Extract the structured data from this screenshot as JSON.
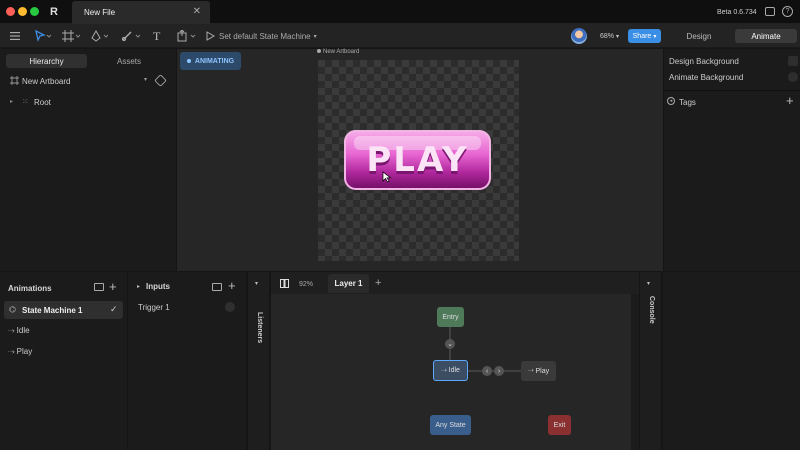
{
  "window": {
    "tab_title": "New File",
    "version": "Beta 0.6.734"
  },
  "toolbar": {
    "state_machine_label": "Set default State Machine",
    "zoom": "68%",
    "share_label": "Share",
    "mode_tabs": [
      "Design",
      "Animate"
    ],
    "active_mode": "Animate"
  },
  "left_panel": {
    "tabs": [
      "Hierarchy",
      "Assets"
    ],
    "artboard_name": "New Artboard",
    "root_label": "Root"
  },
  "canvas": {
    "animating_badge": "ANIMATING",
    "artboard_label": "New Artboard",
    "button_text": "PLAY"
  },
  "right_panel": {
    "design_background": "Design Background",
    "animate_background": "Animate Background",
    "tags_label": "Tags"
  },
  "animations": {
    "title": "Animations",
    "items": [
      "State Machine 1",
      "Idle",
      "Play"
    ]
  },
  "inputs": {
    "title": "Inputs",
    "items": [
      "Trigger 1"
    ]
  },
  "listeners_label": "Listeners",
  "console_label": "Console",
  "graph": {
    "zoom": "92%",
    "layer_tab": "Layer 1",
    "nodes": {
      "entry": "Entry",
      "idle": "Idle",
      "play": "Play",
      "any_state": "Any State",
      "exit": "Exit"
    }
  },
  "colors": {
    "accent_blue": "#3b8ee6",
    "entry": "#4e7a5a",
    "exit": "#8a3030",
    "any_state": "#3a5e8c",
    "button_pink": "#e05cc8"
  }
}
